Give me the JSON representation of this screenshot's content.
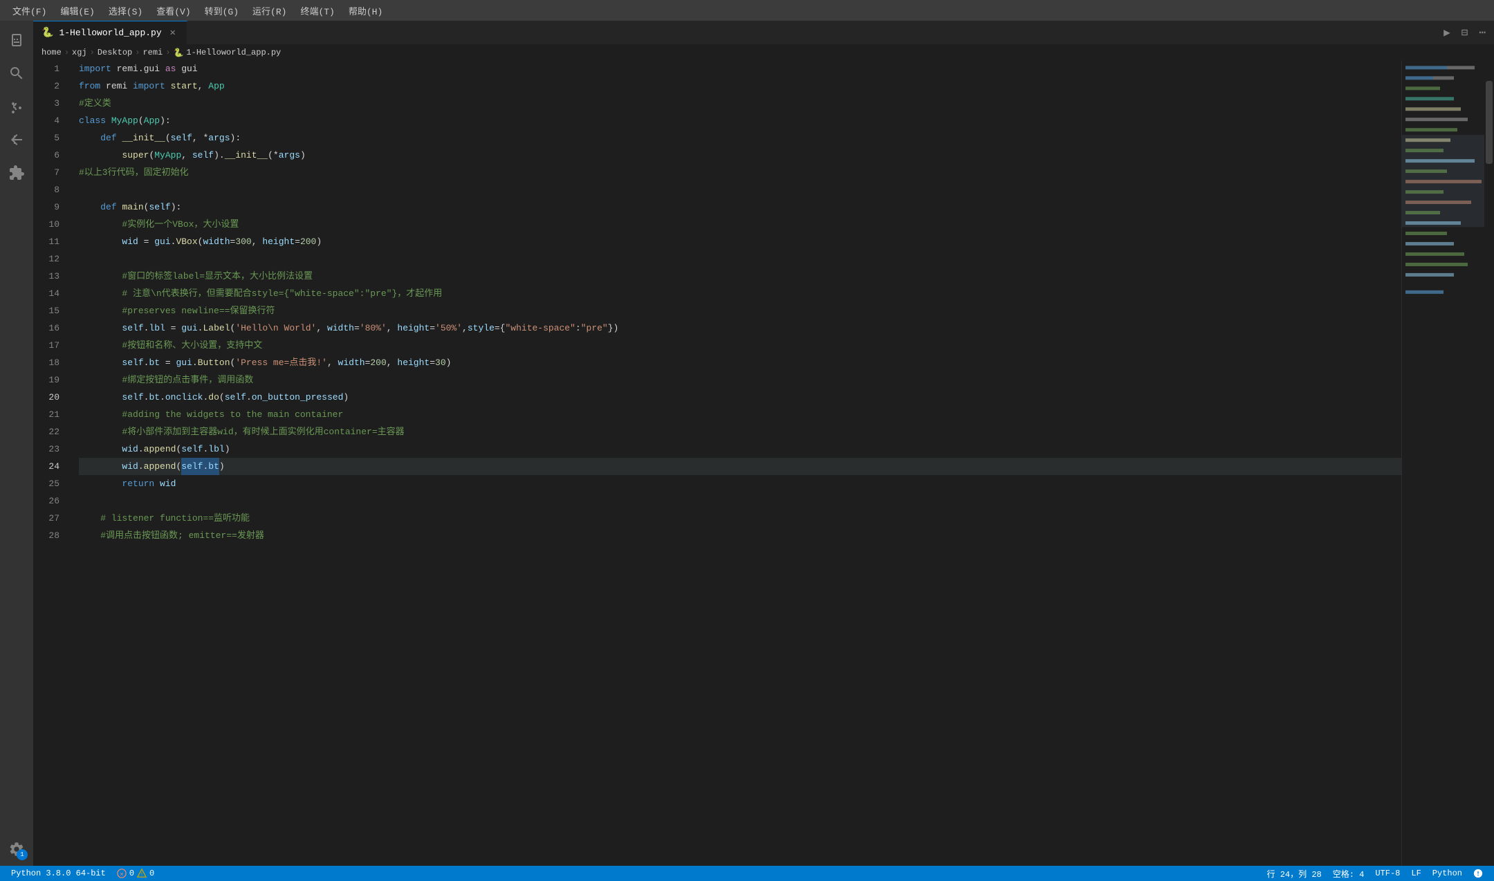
{
  "menubar": {
    "items": [
      {
        "label": "文件(F)"
      },
      {
        "label": "编辑(E)"
      },
      {
        "label": "选择(S)"
      },
      {
        "label": "查看(V)"
      },
      {
        "label": "转到(G)"
      },
      {
        "label": "运行(R)"
      },
      {
        "label": "终端(T)"
      },
      {
        "label": "帮助(H)"
      }
    ]
  },
  "tab": {
    "filename": "1-Helloworld_app.py",
    "icon": "🐍"
  },
  "breadcrumb": {
    "items": [
      "home",
      "xgj",
      "Desktop",
      "remi",
      "1-Helloworld_app.py"
    ]
  },
  "statusbar": {
    "python_version": "Python 3.8.0 64-bit",
    "errors": "0",
    "warnings": "0",
    "line": "行 24，列 28",
    "spaces": "空格: 4",
    "encoding": "UTF-8",
    "eol": "LF",
    "language": "Python"
  },
  "code": {
    "lines": [
      {
        "num": 1,
        "content": "import remi.gui as gui"
      },
      {
        "num": 2,
        "content": "from remi import start, App"
      },
      {
        "num": 3,
        "content": "#定义类"
      },
      {
        "num": 4,
        "content": "class MyApp(App):"
      },
      {
        "num": 5,
        "content": "    def __init__(self, *args):"
      },
      {
        "num": 6,
        "content": "        super(MyApp, self).__init__(*args)"
      },
      {
        "num": 7,
        "content": "#以上3行代码，固定初始化"
      },
      {
        "num": 8,
        "content": ""
      },
      {
        "num": 9,
        "content": "    def main(self):"
      },
      {
        "num": 10,
        "content": "        #实例化一个VBox，大小设置"
      },
      {
        "num": 11,
        "content": "        wid = gui.VBox(width=300, height=200)"
      },
      {
        "num": 12,
        "content": ""
      },
      {
        "num": 13,
        "content": "        #窗口的标签label=显示文本，大小比例法设置"
      },
      {
        "num": 14,
        "content": "        # 注意\\n代表换行，但需要配合style={\"white-space\":\"pre\"}，才起作用"
      },
      {
        "num": 15,
        "content": "        #preserves newline==保留换行符"
      },
      {
        "num": 16,
        "content": "        self.lbl = gui.Label('Hello\\n World', width='80%', height='50%',style={\"white-space\":\"pre\"})"
      },
      {
        "num": 17,
        "content": "        #按钮和名称、大小设置，支持中文"
      },
      {
        "num": 18,
        "content": "        self.bt = gui.Button('Press me=点击我!', width=200, height=30)"
      },
      {
        "num": 19,
        "content": "        #绑定按钮的点击事件，调用函数"
      },
      {
        "num": 20,
        "content": "        self.bt.onclick.do(self.on_button_pressed)"
      },
      {
        "num": 21,
        "content": "        #adding the widgets to the main container"
      },
      {
        "num": 22,
        "content": "        #将小部件添加到主容器wid，有时候上面实例化用container=主容器"
      },
      {
        "num": 23,
        "content": "        wid.append(self.lbl)"
      },
      {
        "num": 24,
        "content": "        wid.append(self.bt)"
      },
      {
        "num": 25,
        "content": "        return wid"
      },
      {
        "num": 26,
        "content": ""
      },
      {
        "num": 27,
        "content": "    # listener function==监听功能"
      },
      {
        "num": 28,
        "content": "    #调用点击按钮函数; emitter==发射器"
      }
    ]
  }
}
